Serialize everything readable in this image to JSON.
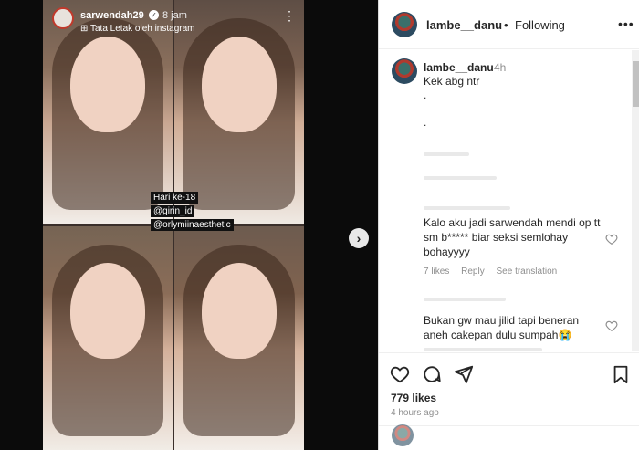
{
  "story": {
    "username": "sarwendah29",
    "time": "8 jam",
    "layout_label": "Tata Letak oleh instagram",
    "tags": [
      "Hari ke-18",
      "@girin_id",
      "@orlymiinaesthetic"
    ]
  },
  "post": {
    "username": "lambe__danu",
    "separator": "•",
    "follow_status": "Following",
    "caption": {
      "username": "lambe__danu",
      "time": "4h",
      "text": "Kek abg ntr",
      "dot1": ".",
      "dot2": "."
    },
    "comments": [
      {
        "text": "Kalo aku jadi sarwendah mendi op tt sm b***** biar seksi semlohay bohayyyy",
        "likes": "7 likes",
        "reply": "Reply",
        "translation": "See translation"
      },
      {
        "text": "Bukan gw mau jilid tapi beneran aneh cakepan dulu sumpah😭"
      }
    ],
    "likes": "779 likes",
    "ago": "4 hours ago"
  },
  "colors": {
    "text": "#262626",
    "muted": "#8e8e8e",
    "media_bg": "#0b0b0b"
  },
  "icons": {
    "next": "chevron-right-icon",
    "like": "heart-icon",
    "comment": "comment-icon",
    "share": "share-icon",
    "save": "bookmark-icon",
    "more": "more-dots-icon"
  }
}
